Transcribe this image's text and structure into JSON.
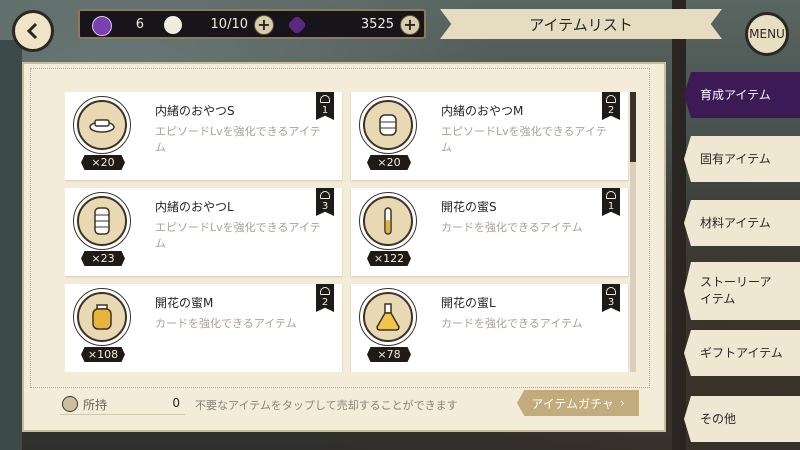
{
  "header": {
    "title": "アイテムリスト",
    "menu_label": "MENU",
    "resources": {
      "star_value": "6",
      "stamina_value": "10/10",
      "gem_value": "3525"
    }
  },
  "items": [
    {
      "name": "内緒のおやつS",
      "desc": "エピソードLvを強化できるアイテム",
      "count": "×20",
      "rank": "1",
      "icon": "cake-plate-icon"
    },
    {
      "name": "内緒のおやつM",
      "desc": "エピソードLvを強化できるアイテム",
      "count": "×20",
      "rank": "2",
      "icon": "cake-stack-icon"
    },
    {
      "name": "内緒のおやつL",
      "desc": "エピソードLvを強化できるアイテム",
      "count": "×23",
      "rank": "3",
      "icon": "cake-tower-icon"
    },
    {
      "name": "開花の蜜S",
      "desc": "カードを強化できるアイテム",
      "count": "×122",
      "rank": "1",
      "icon": "vial-icon"
    },
    {
      "name": "開花の蜜M",
      "desc": "カードを強化できるアイテム",
      "count": "×108",
      "rank": "2",
      "icon": "jar-icon"
    },
    {
      "name": "開花の蜜L",
      "desc": "カードを強化できるアイテム",
      "count": "×78",
      "rank": "3",
      "icon": "flask-icon"
    }
  ],
  "footer": {
    "owned_label": "所持",
    "owned_value": "0",
    "note": "不要なアイテムをタップして売却することができます",
    "gacha_label": "アイテムガチャ"
  },
  "tabs": [
    {
      "label": "育成アイテム",
      "active": true
    },
    {
      "label": "固有アイテム",
      "active": false
    },
    {
      "label": "材料アイテム",
      "active": false
    },
    {
      "label": "ストーリーアイテム",
      "active": false
    },
    {
      "label": "ギフトアイテム",
      "active": false
    },
    {
      "label": "その他",
      "active": false
    }
  ],
  "colors": {
    "active_tab": "#3b1a55",
    "panel": "#f3ecd9",
    "gacha": "#c2ab7d"
  }
}
